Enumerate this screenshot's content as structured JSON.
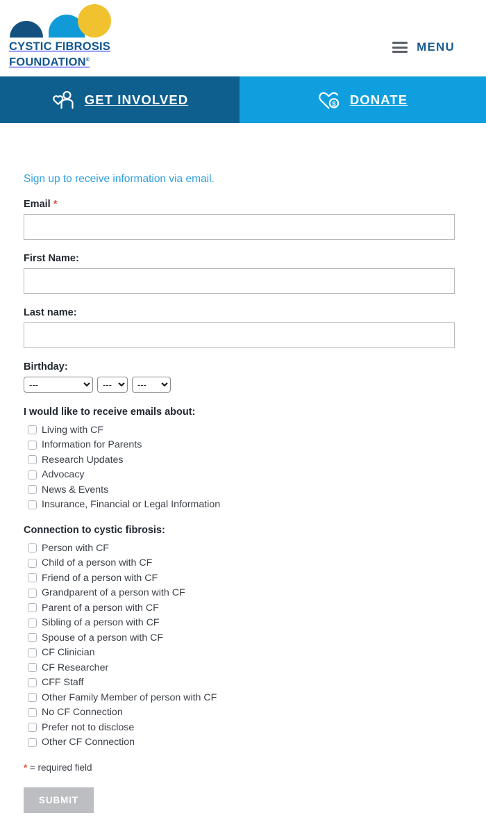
{
  "header": {
    "logo": {
      "line1": "CYSTIC FIBROSIS",
      "line2": "FOUNDATION",
      "registered": "®",
      "colors": {
        "dark_blue": "#12517f",
        "light_blue": "#109bd8",
        "yellow": "#f0c230",
        "wordmark": "#11578f"
      }
    },
    "menu_label": "MENU"
  },
  "actionbar": {
    "items": [
      {
        "label": "GET INVOLVED",
        "icon": "people-heart-icon",
        "bg": "#0e5f8e"
      },
      {
        "label": "DONATE",
        "icon": "heart-dollar-icon",
        "bg": "#0f9fdf"
      }
    ]
  },
  "form": {
    "signup_link": "Sign up to receive information via email.",
    "signup_link_color": "#2f9fde",
    "email": {
      "label": "Email",
      "required_marker": "*",
      "value": "",
      "placeholder": ""
    },
    "first_name": {
      "label": "First Name:",
      "value": "",
      "placeholder": ""
    },
    "last_name": {
      "label": "Last name:",
      "value": "",
      "placeholder": ""
    },
    "birthday": {
      "label": "Birthday:",
      "year": {
        "selected": "---",
        "options": [
          "---"
        ]
      },
      "month": {
        "selected": "---",
        "options": [
          "---"
        ]
      },
      "day": {
        "selected": "---",
        "options": [
          "---"
        ]
      }
    },
    "emails_about": {
      "title": "I would like to receive emails about:",
      "options": [
        {
          "label": "Living with CF",
          "checked": false
        },
        {
          "label": "Information for Parents",
          "checked": false
        },
        {
          "label": "Research Updates",
          "checked": false
        },
        {
          "label": "Advocacy",
          "checked": false
        },
        {
          "label": "News & Events",
          "checked": false
        },
        {
          "label": "Insurance, Financial or Legal Information",
          "checked": false
        }
      ]
    },
    "connection": {
      "title": "Connection to cystic fibrosis:",
      "options": [
        {
          "label": "Person with CF",
          "checked": false
        },
        {
          "label": "Child of a person with CF",
          "checked": false
        },
        {
          "label": "Friend of a person with CF",
          "checked": false
        },
        {
          "label": "Grandparent of a person with CF",
          "checked": false
        },
        {
          "label": "Parent of a person with CF",
          "checked": false
        },
        {
          "label": "Sibling of a person with CF",
          "checked": false
        },
        {
          "label": "Spouse of a person with CF",
          "checked": false
        },
        {
          "label": "CF Clinician",
          "checked": false
        },
        {
          "label": "CF Researcher",
          "checked": false
        },
        {
          "label": "CFF Staff",
          "checked": false
        },
        {
          "label": "Other Family Member of person with CF",
          "checked": false
        },
        {
          "label": "No CF Connection",
          "checked": false
        },
        {
          "label": "Prefer not to disclose",
          "checked": false
        },
        {
          "label": "Other CF Connection",
          "checked": false
        }
      ]
    },
    "required_note": {
      "star": "*",
      "text": "= required field"
    },
    "submit_label": "SUBMIT",
    "submit_bg": "#bcbec1"
  }
}
